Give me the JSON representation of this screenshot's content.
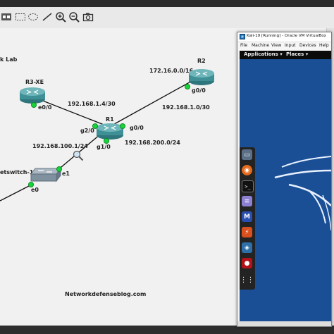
{
  "toolbar": {
    "icons": [
      "screenshot-icon",
      "select-rect-icon",
      "ellipse-icon",
      "line-icon",
      "zoom-in-icon",
      "zoom-out-icon",
      "camera-icon"
    ]
  },
  "topology": {
    "title_partial": "k Lab",
    "devices": {
      "r3xe": {
        "name": "R3-XE",
        "port": "e0/0"
      },
      "r2": {
        "name": "R2",
        "network": "172.16.0.0/16",
        "port": "g0/0"
      },
      "r1": {
        "name": "R1",
        "port_g2": "g2/0",
        "port_g0": "g0/0",
        "port_g1": "g1/0"
      },
      "switch": {
        "name": "etswitch-1",
        "port_e1": "e1",
        "port_e0": "e0"
      }
    },
    "links": {
      "r3_r1": "192.168.1.4/30",
      "r2_r1": "192.168.1.0/30",
      "r1_net200": "192.168.200.0/24",
      "r1_net100": "192.168.100.1/24"
    },
    "footer": "Networkdefenseblog.com"
  },
  "vbox": {
    "title": "Kali-19 [Running] - Oracle VM VirtualBox",
    "menu": [
      "File",
      "Machine",
      "View",
      "Input",
      "Devices",
      "Help"
    ],
    "kali": {
      "applications": "Applications ▾",
      "places": "Places ▾"
    }
  },
  "colors": {
    "router": "#3e8f96",
    "link_dot": "#18d43a",
    "kali_bg": "#1b4f95"
  }
}
